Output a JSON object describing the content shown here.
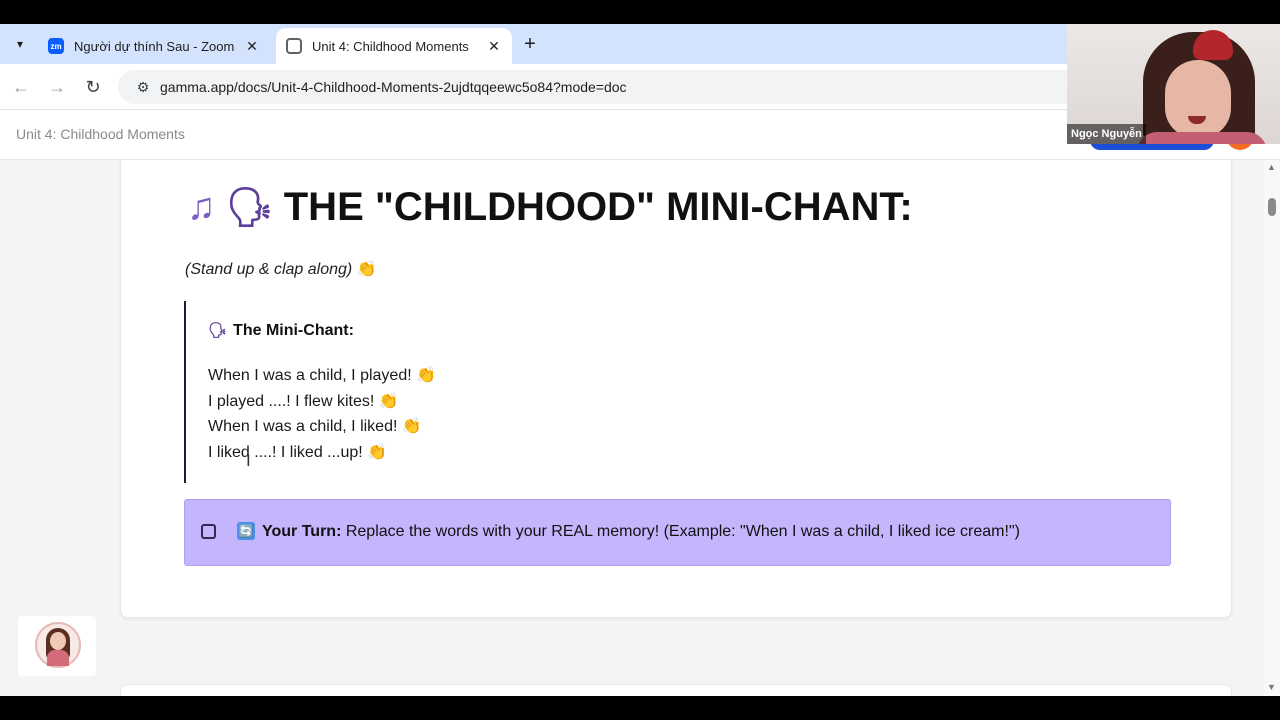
{
  "browser": {
    "tabs": [
      {
        "title": "Người dự thính Sau - Zoom",
        "favicon": "zoom-icon",
        "active": false
      },
      {
        "title": "Unit 4: Childhood Moments",
        "favicon": "gamma-icon",
        "active": true
      }
    ],
    "url": "gamma.app/docs/Unit-4-Childhood-Moments-2ujdtqqeewc5o84?mode=doc"
  },
  "header": {
    "doc_title": "Unit 4: Childhood Moments"
  },
  "card": {
    "heading": "THE \"CHILDHOOD\" MINI-CHANT:",
    "heading_icons": [
      "music-notes-icon",
      "speaking-head-icon"
    ],
    "subtitle": "(Stand up & clap along)",
    "quote_title": "The Mini-Chant:",
    "chant_lines": [
      "When I was a child, I played!",
      "I played ....! I flew kites!",
      "When I was a child, I liked!",
      "I liked ....! I liked ...up!"
    ],
    "callout": {
      "label": "Your Turn:",
      "text": " Replace the words with your REAL memory! (Example: \"When I was a child, I liked ice cream!\")"
    }
  },
  "webcam": {
    "participant_name": "Ngọc Nguyễn"
  },
  "colors": {
    "tabstrip": "#d3e3fd",
    "callout_bg": "#c4b5fd",
    "share_button": "#1d4ed8",
    "avatar": "#f26b21"
  }
}
